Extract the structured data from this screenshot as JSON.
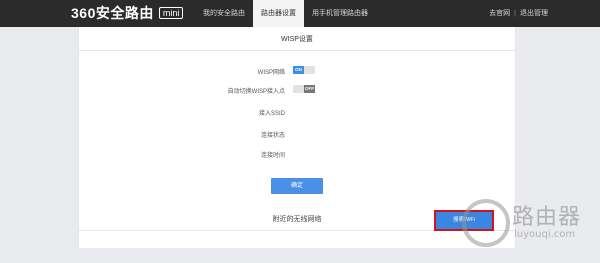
{
  "header": {
    "brand": "360安全路由",
    "brand_badge": "mini",
    "tabs": [
      {
        "label": "我的安全路由",
        "active": false
      },
      {
        "label": "路由器设置",
        "active": true
      },
      {
        "label": "用手机管理路由器",
        "active": false
      }
    ],
    "right_links": {
      "official_site": "去官网",
      "separator": "|",
      "logout": "退出管理"
    }
  },
  "panel": {
    "title": "WISP设置",
    "rows": [
      {
        "label": "WISP网络",
        "control": "toggle",
        "state": "on",
        "state_text": "ON"
      },
      {
        "label": "自动切换WISP接入点",
        "control": "toggle",
        "state": "off",
        "state_text": "OFF"
      },
      {
        "label": "接入SSID"
      },
      {
        "label": "连接状态"
      },
      {
        "label": "连接时间"
      }
    ],
    "confirm_label": "确定",
    "nearby_title": "附近的无线网络",
    "search_wifi_label": "搜索WiFi"
  },
  "watermark": {
    "text": "路由器",
    "sub": "luyouqi.com"
  },
  "colors": {
    "topbar": "#2b2b2b",
    "accent": "#3b8ee8",
    "highlight_box": "#d0141b",
    "background": "#e9ebee"
  }
}
